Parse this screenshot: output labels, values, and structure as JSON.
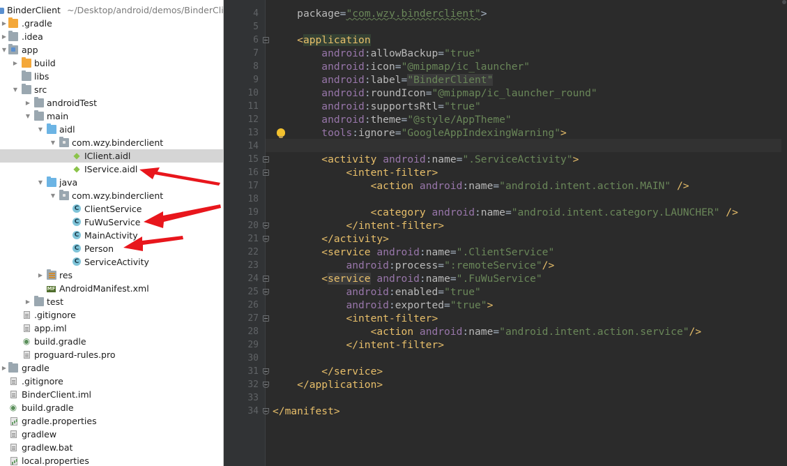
{
  "project_tree": {
    "root": {
      "name": "BinderClient",
      "path": "~/Desktop/android/demos/BinderClient"
    },
    "items": [
      {
        "label": ".gradle"
      },
      {
        "label": ".idea"
      },
      {
        "label": "app"
      },
      {
        "label": "build"
      },
      {
        "label": "libs"
      },
      {
        "label": "src"
      },
      {
        "label": "androidTest"
      },
      {
        "label": "main"
      },
      {
        "label": "aidl"
      },
      {
        "label": "com.wzy.binderclient"
      },
      {
        "label": "IClient.aidl"
      },
      {
        "label": "IService.aidl"
      },
      {
        "label": "java"
      },
      {
        "label": "com.wzy.binderclient"
      },
      {
        "label": "ClientService"
      },
      {
        "label": "FuWuService"
      },
      {
        "label": "MainActivity"
      },
      {
        "label": "Person"
      },
      {
        "label": "ServiceActivity"
      },
      {
        "label": "res"
      },
      {
        "label": "AndroidManifest.xml"
      },
      {
        "label": "test"
      },
      {
        "label": ".gitignore"
      },
      {
        "label": "app.iml"
      },
      {
        "label": "build.gradle"
      },
      {
        "label": "proguard-rules.pro"
      },
      {
        "label": "gradle"
      },
      {
        "label": ".gitignore"
      },
      {
        "label": "BinderClient.iml"
      },
      {
        "label": "build.gradle"
      },
      {
        "label": "gradle.properties"
      },
      {
        "label": "gradlew"
      },
      {
        "label": "gradlew.bat"
      },
      {
        "label": "local.properties"
      }
    ],
    "manifest_badge": "MF"
  },
  "editor": {
    "line_numbers": [
      "4",
      "5",
      "6",
      "7",
      "8",
      "9",
      "10",
      "11",
      "12",
      "13",
      "14",
      "15",
      "16",
      "17",
      "18",
      "19",
      "20",
      "21",
      "22",
      "23",
      "24",
      "25",
      "26",
      "27",
      "28",
      "29",
      "30",
      "31",
      "32",
      "33",
      "34"
    ],
    "tokens": {
      "package_attr": "package",
      "package_val": "\"com.wzy.binderclient\"",
      "application": "application",
      "android": "android",
      "tools": "tools",
      "allowBackup": "allowBackup",
      "allowBackup_val": "\"true\"",
      "icon": "icon",
      "icon_val": "\"@mipmap/ic_launcher\"",
      "label": "label",
      "label_val": "\"BinderClient\"",
      "roundIcon": "roundIcon",
      "roundIcon_val": "\"@mipmap/ic_launcher_round\"",
      "supportsRtl": "supportsRtl",
      "supportsRtl_val": "\"true\"",
      "theme": "theme",
      "theme_val": "\"@style/AppTheme\"",
      "ignore": "ignore",
      "ignore_val": "\"GoogleAppIndexingWarning\"",
      "activity": "activity",
      "name": "name",
      "activity_name_val": "\".ServiceActivity\"",
      "intent_filter": "intent-filter",
      "action": "action",
      "action_main_val": "\"android.intent.action.MAIN\"",
      "category": "category",
      "category_launcher_val": "\"android.intent.category.LAUNCHER\"",
      "service": "service",
      "service1_name_val": "\".ClientService\"",
      "process": "process",
      "process_val": "\":remoteService\"",
      "service2_name_val": "\".FuWuService\"",
      "enabled": "enabled",
      "enabled_val": "\"true\"",
      "exported": "exported",
      "exported_val": "\"true\"",
      "action_service_val": "\"android.intent.action.service\"",
      "manifest": "manifest"
    }
  },
  "colors": {
    "tag": "#e8bf6a",
    "namespace": "#9876aa",
    "attribute": "#bababa",
    "value": "#6a8759",
    "annotation_arrow": "#e8161c"
  },
  "icons": {
    "bulb": "intention-bulb-icon",
    "fold": "fold-marker-icon"
  }
}
